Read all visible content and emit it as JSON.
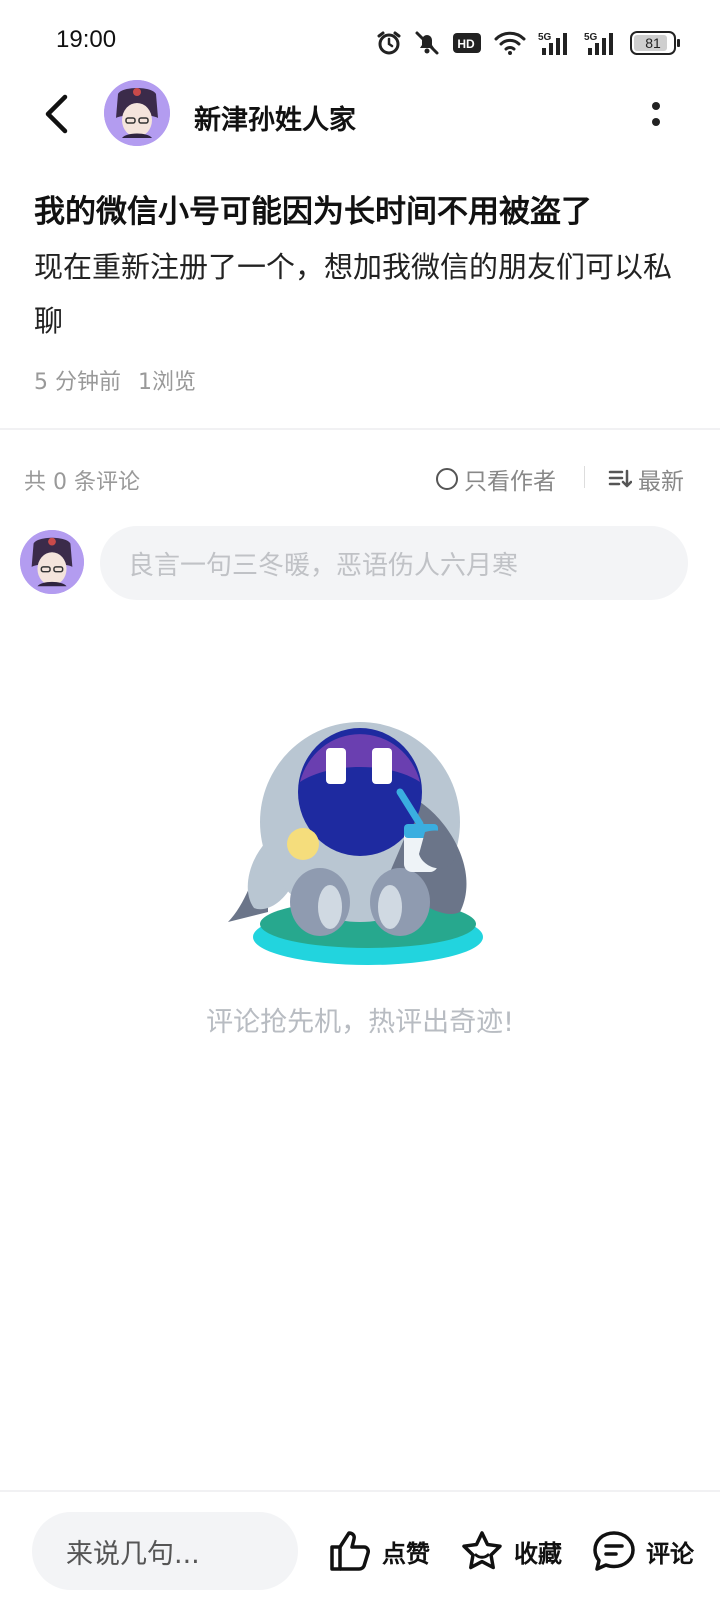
{
  "status_bar": {
    "time": "19:00",
    "icons": [
      "alarm-icon",
      "mute-icon",
      "hd-icon",
      "wifi-icon",
      "5g-signal-icon",
      "5g-signal-icon",
      "battery-icon"
    ],
    "hd_label": "HD",
    "network_label_1": "5G",
    "network_label_2": "5G",
    "battery_level": "81"
  },
  "header": {
    "back_icon": "chevron-left-icon",
    "author_name": "新津孙姓人家",
    "more_icon": "more-vertical-icon"
  },
  "post": {
    "title": "我的微信小号可能因为长时间不用被盗了",
    "body": "现在重新注册了一个，想加我微信的朋友们可以私聊",
    "time_ago": "5 分钟前",
    "views": "1浏览"
  },
  "comments": {
    "count_label": "共 0 条评论",
    "only_author_label": "只看作者",
    "sort_label": "最新",
    "input_placeholder": "良言一句三冬暖，恶语伤人六月寒",
    "empty_text": "评论抢先机，热评出奇迹!"
  },
  "bottom_bar": {
    "input_placeholder": "来说几句...",
    "like_label": "点赞",
    "favorite_label": "收藏",
    "comment_label": "评论"
  },
  "colors": {
    "avatar_bg": "#b39cf0",
    "muted_text": "#999999",
    "input_bg": "#f3f4f6"
  }
}
